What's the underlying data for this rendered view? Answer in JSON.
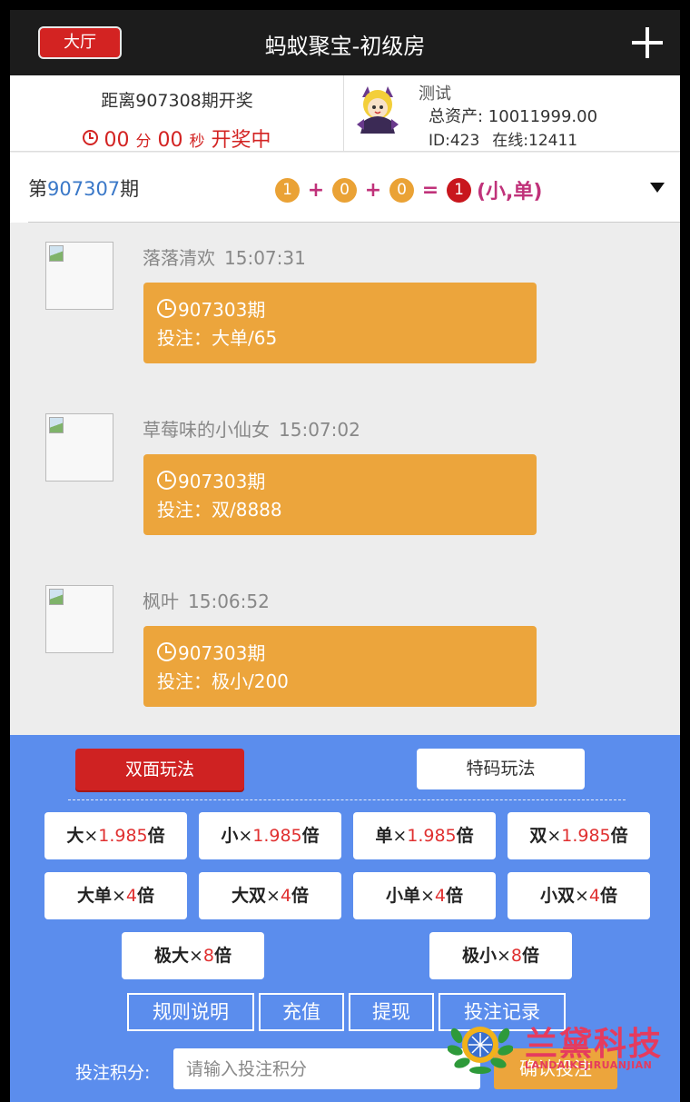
{
  "header": {
    "lobby_label": "大厅",
    "title": "蚂蚁聚宝-初级房",
    "add_icon": "plus-icon"
  },
  "draw": {
    "next_label": "距离907308期开奖",
    "minutes": "00",
    "minutes_unit": "分",
    "seconds": "00",
    "seconds_unit": "秒",
    "status": "开奖中"
  },
  "user": {
    "name": "测试",
    "assets": "总资产: 10011999.00",
    "id": "ID:423",
    "online": "在线:12411"
  },
  "result": {
    "prefix": "第",
    "period": "907307",
    "suffix": "期",
    "balls": [
      "1",
      "0",
      "0"
    ],
    "plus": "+",
    "equals": "=",
    "sum": "1",
    "tag": "(小,单)"
  },
  "messages": [
    {
      "user": "落落清欢",
      "time": "15:07:31",
      "issue": "907303期",
      "bet": "投注：大单/65"
    },
    {
      "user": "草莓味的小仙女",
      "time": "15:07:02",
      "issue": "907303期",
      "bet": "投注：双/8888"
    },
    {
      "user": "枫叶",
      "time": "15:06:52",
      "issue": "907303期",
      "bet": "投注：极小/200"
    }
  ],
  "panel": {
    "mode_dual": "双面玩法",
    "mode_special": "特码玩法",
    "bets": [
      {
        "name": "大",
        "x": "×",
        "mul": "1.985",
        "unit": "倍"
      },
      {
        "name": "小",
        "x": "×",
        "mul": "1.985",
        "unit": "倍"
      },
      {
        "name": "单",
        "x": "×",
        "mul": "1.985",
        "unit": "倍"
      },
      {
        "name": "双",
        "x": "×",
        "mul": "1.985",
        "unit": "倍"
      },
      {
        "name": "大单",
        "x": "×",
        "mul": "4",
        "unit": "倍"
      },
      {
        "name": "大双",
        "x": "×",
        "mul": "4",
        "unit": "倍"
      },
      {
        "name": "小单",
        "x": "×",
        "mul": "4",
        "unit": "倍"
      },
      {
        "name": "小双",
        "x": "×",
        "mul": "4",
        "unit": "倍"
      },
      {
        "name": "极大",
        "x": "×",
        "mul": "8",
        "unit": "倍"
      },
      {
        "name": "极小",
        "x": "×",
        "mul": "8",
        "unit": "倍"
      }
    ],
    "actions": [
      "规则说明",
      "充值",
      "提现",
      "投注记录"
    ],
    "points_label": "投注积分:",
    "points_placeholder": "请输入投注积分",
    "confirm": "确认投注"
  },
  "watermark": {
    "text": "兰黛科技",
    "sub": "LANDAIKEJIRUANJIAN"
  },
  "colors": {
    "header_bg": "#1c1c1c",
    "accent_red": "#d32322",
    "bubble_orange": "#eca53c",
    "panel_blue": "#5b8ded",
    "period_blue": "#3a78c8",
    "result_magenta": "#c0327a"
  }
}
